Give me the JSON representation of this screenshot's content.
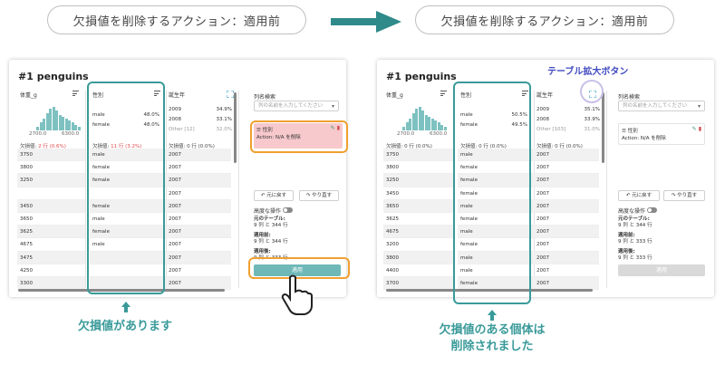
{
  "header": {
    "left_title": "欠損値を削除するアクション：適用前",
    "right_title": "欠損値を削除するアクション：適用前"
  },
  "colors": {
    "teal": "#3a9a9a",
    "orange": "#f0a030",
    "pink": "#f7c9cc",
    "callout": "#3f49c0"
  },
  "left_panel": {
    "title": "#1 penguins",
    "columns": {
      "body_mass": "体重_g",
      "sex": "性別",
      "year": "誕生年"
    },
    "hist_min": "2700.0",
    "hist_max": "6300.0",
    "sex_stats": [
      {
        "label": "male",
        "pct": "48.0%"
      },
      {
        "label": "female",
        "pct": "48.0%"
      }
    ],
    "year_stats": [
      {
        "label": "2009",
        "pct": "34.9%"
      },
      {
        "label": "2008",
        "pct": "33.1%"
      },
      {
        "label": "Other [12]",
        "pct": "32.0%"
      }
    ],
    "missing": {
      "body_prefix": "欠損値:",
      "body_val": "2 行 (0.6%)",
      "sex_prefix": "欠損値:",
      "sex_val": "11 行 (3.2%)",
      "year_text": "欠損値: 0 行 (0.0%)"
    },
    "body_values": [
      "3750",
      "3800",
      "3250",
      "",
      "3450",
      "3650",
      "3625",
      "4675",
      "3475",
      "4250",
      "3300"
    ],
    "sex_values": [
      "male",
      "female",
      "female",
      "",
      "female",
      "male",
      "female",
      "male",
      "",
      "",
      ""
    ],
    "year_values": [
      "2007",
      "2007",
      "2007",
      "2007",
      "2007",
      "2007",
      "2007",
      "2007",
      "2007",
      "2007",
      "2007"
    ],
    "sidebar": {
      "search_label": "列名検索",
      "search_placeholder": "列の名前を入力してください",
      "action_title": "性別",
      "action_desc": "Action: N/A を削除",
      "undo": "元に戻す",
      "redo": "やり直す",
      "advanced": "高度な操作",
      "orig_table_label": "元のテーブル:",
      "orig_table_val": "9 列 と 344 行",
      "before_label": "適用前:",
      "before_val": "9 列 と 344 行",
      "after_label": "適用後:",
      "after_val": "9 列 と 333 行",
      "apply": "適用"
    }
  },
  "right_panel": {
    "title": "#1 penguins",
    "columns": {
      "body_mass": "体重_g",
      "sex": "性別",
      "year": "誕生年"
    },
    "hist_min": "2700.0",
    "hist_max": "6300.0",
    "sex_stats": [
      {
        "label": "male",
        "pct": "50.5%"
      },
      {
        "label": "female",
        "pct": "49.5%"
      }
    ],
    "year_stats": [
      {
        "label": "2009",
        "pct": "35.1%"
      },
      {
        "label": "2008",
        "pct": "33.9%"
      },
      {
        "label": "Other [103]",
        "pct": "31.0%"
      }
    ],
    "missing": {
      "body_text": "欠損値: 0 行 (0.0%)",
      "sex_text": "欠損値: 0 行 (0.0%)",
      "year_text": "欠損値: 0 行 (0.0%)"
    },
    "body_values": [
      "3750",
      "3800",
      "3250",
      "3450",
      "3650",
      "3625",
      "4675",
      "3200",
      "3800",
      "4400",
      "3700"
    ],
    "sex_values": [
      "male",
      "female",
      "female",
      "female",
      "male",
      "female",
      "male",
      "female",
      "male",
      "male",
      "female"
    ],
    "year_values": [
      "2007",
      "2007",
      "2007",
      "2007",
      "2007",
      "2007",
      "2007",
      "2007",
      "2007",
      "2007",
      "2007"
    ],
    "sidebar": {
      "search_label": "列名検索",
      "search_placeholder": "列の名前を入力してください",
      "action_title": "性別",
      "action_desc": "Action: N/A を削除",
      "undo": "元に戻す",
      "redo": "やり直す",
      "advanced": "高度な操作",
      "orig_table_label": "元のテーブル:",
      "orig_table_val": "9 列 と 344 行",
      "before_label": "適用前:",
      "before_val": "9 列 と 333 行",
      "after_label": "適用後:",
      "after_val": "9 列 と 333 行",
      "apply": "適用"
    }
  },
  "captions": {
    "left": "欠損値があります",
    "right_line1": "欠損値のある個体は",
    "right_line2": "削除されました",
    "expand_callout": "テーブル拡大ボタン"
  },
  "histogram_bars": [
    2,
    4,
    6,
    9,
    11,
    12,
    10,
    8,
    7,
    6,
    5,
    4,
    3,
    2
  ]
}
